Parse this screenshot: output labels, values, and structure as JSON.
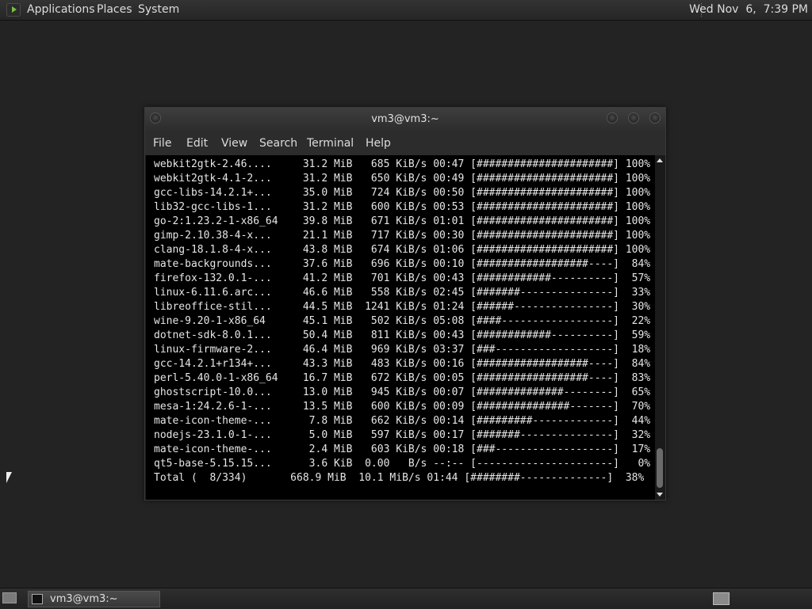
{
  "top_panel": {
    "menus": [
      "Applications",
      "Places",
      "System"
    ],
    "clock": "Wed Nov  6,  7:39 PM"
  },
  "window": {
    "title": "vm3@vm3:~",
    "menubar": [
      "File",
      "Edit",
      "View",
      "Search",
      "Terminal",
      "Help"
    ]
  },
  "terminal_lines": [
    "webkit2gtk-2.46....     31.2 MiB   685 KiB/s 00:47 [######################] 100%",
    "webkit2gtk-4.1-2...     31.2 MiB   650 KiB/s 00:49 [######################] 100%",
    "gcc-libs-14.2.1+...     35.0 MiB   724 KiB/s 00:50 [######################] 100%",
    "lib32-gcc-libs-1...     31.2 MiB   600 KiB/s 00:53 [######################] 100%",
    "go-2:1.23.2-1-x86_64    39.8 MiB   671 KiB/s 01:01 [######################] 100%",
    "gimp-2.10.38-4-x...     21.1 MiB   717 KiB/s 00:30 [######################] 100%",
    "clang-18.1.8-4-x...     43.8 MiB   674 KiB/s 01:06 [######################] 100%",
    "mate-backgrounds...     37.6 MiB   696 KiB/s 00:10 [##################----]  84%",
    "firefox-132.0.1-...     41.2 MiB   701 KiB/s 00:43 [############----------]  57%",
    "linux-6.11.6.arc...     46.6 MiB   558 KiB/s 02:45 [#######---------------]  33%",
    "libreoffice-stil...     44.5 MiB  1241 KiB/s 01:24 [######----------------]  30%",
    "wine-9.20-1-x86_64      45.1 MiB   502 KiB/s 05:08 [####------------------]  22%",
    "dotnet-sdk-8.0.1...     50.4 MiB   811 KiB/s 00:43 [############----------]  59%",
    "linux-firmware-2...     46.4 MiB   969 KiB/s 03:37 [###-------------------]  18%",
    "gcc-14.2.1+r134+...     43.3 MiB   483 KiB/s 00:16 [##################----]  84%",
    "perl-5.40.0-1-x86_64    16.7 MiB   672 KiB/s 00:05 [##################----]  83%",
    "ghostscript-10.0...     13.0 MiB   945 KiB/s 00:07 [##############--------]  65%",
    "mesa-1:24.2.6-1-...     13.5 MiB   600 KiB/s 00:09 [###############-------]  70%",
    "mate-icon-theme-...      7.8 MiB   662 KiB/s 00:14 [#########-------------]  44%",
    "nodejs-23.1.0-1-...      5.0 MiB   597 KiB/s 00:17 [#######---------------]  32%",
    "mate-icon-theme-...      2.4 MiB   603 KiB/s 00:18 [###-------------------]  17%",
    "qt5-base-5.15.15...      3.6 KiB  0.00   B/s --:-- [----------------------]   0%",
    "Total (  8/334)       668.9 MiB  10.1 MiB/s 01:44 [########--------------]  38%"
  ],
  "taskbar": {
    "task_label": "vm3@vm3:~"
  },
  "colors": {
    "desktop_bg": "#232323",
    "terminal_bg": "#000000",
    "terminal_fg": "#e6e6e6",
    "panel_bg": "#2a2a2a"
  }
}
